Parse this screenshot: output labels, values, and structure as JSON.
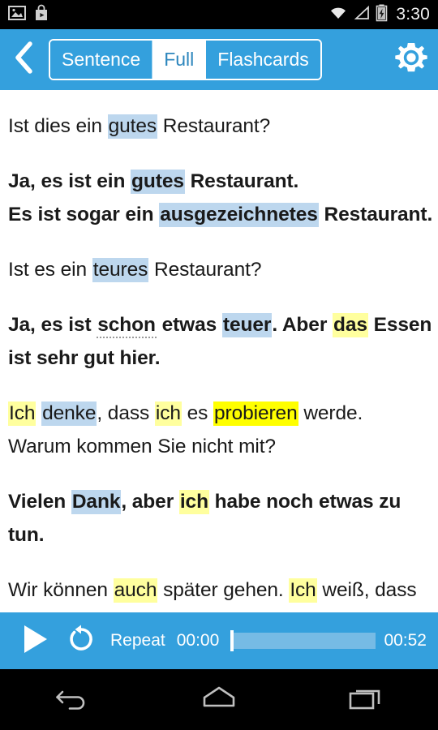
{
  "status_bar": {
    "time": "3:30",
    "left_icons": [
      "screenshot-image-icon",
      "play-store-icon"
    ],
    "right_icons": [
      "wifi-icon",
      "cell-signal-icon",
      "battery-charging-icon"
    ]
  },
  "header": {
    "back_icon": "chevron-left-icon",
    "settings_icon": "gear-icon",
    "tabs": [
      {
        "label": "Sentence",
        "active": false
      },
      {
        "label": "Full",
        "active": true
      },
      {
        "label": "Flashcards",
        "active": false
      }
    ],
    "accent_color": "#34a0dd"
  },
  "colors": {
    "highlight_blue": "#bdd7ee",
    "highlight_yellow_pale": "#ffff9e",
    "highlight_yellow_bright": "#ffff00",
    "text": "#1a1a1a",
    "header_blue": "#34a0dd",
    "seek_track": "#76bbe5"
  },
  "transcript": {
    "paragraphs": [
      {
        "id": "p1",
        "bold": false,
        "lines": [
          [
            {
              "t": "Ist dies ein ",
              "h": "none"
            },
            {
              "t": "gutes",
              "h": "blue"
            },
            {
              "t": " Restaurant?",
              "h": "none"
            }
          ]
        ]
      },
      {
        "id": "p2",
        "bold": true,
        "lines": [
          [
            {
              "t": "Ja, es ist ein ",
              "h": "none"
            },
            {
              "t": "gutes",
              "h": "blue"
            },
            {
              "t": " Restaurant.",
              "h": "none"
            }
          ],
          [
            {
              "t": "Es ist sogar ein ",
              "h": "none"
            },
            {
              "t": "ausgezeichnetes",
              "h": "blue"
            },
            {
              "t": " Restaurant.",
              "h": "none"
            }
          ]
        ]
      },
      {
        "id": "p3",
        "bold": false,
        "lines": [
          [
            {
              "t": "Ist es ein ",
              "h": "none"
            },
            {
              "t": "teures",
              "h": "blue"
            },
            {
              "t": " Restaurant?",
              "h": "none"
            }
          ]
        ]
      },
      {
        "id": "p4",
        "bold": true,
        "lines": [
          [
            {
              "t": "Ja, es ist ",
              "h": "none"
            },
            {
              "t": "schon",
              "h": "dotted"
            },
            {
              "t": " etwas ",
              "h": "none"
            },
            {
              "t": "teuer",
              "h": "blue"
            },
            {
              "t": ". Aber ",
              "h": "none"
            },
            {
              "t": "das",
              "h": "yellow-pale"
            },
            {
              "t": " Essen",
              "h": "none"
            }
          ],
          [
            {
              "t": "ist sehr gut hier.",
              "h": "none"
            }
          ]
        ]
      },
      {
        "id": "p5",
        "bold": false,
        "lines": [
          [
            {
              "t": "Ich",
              "h": "yellow-pale"
            },
            {
              "t": " ",
              "h": "none"
            },
            {
              "t": "denke",
              "h": "blue"
            },
            {
              "t": ", dass ",
              "h": "none"
            },
            {
              "t": "ich",
              "h": "yellow-pale"
            },
            {
              "t": " es ",
              "h": "none"
            },
            {
              "t": "probieren",
              "h": "yellow-bright"
            },
            {
              "t": " werde.",
              "h": "none"
            }
          ],
          [
            {
              "t": "Warum kommen Sie nicht mit?",
              "h": "none"
            }
          ]
        ]
      },
      {
        "id": "p6",
        "bold": true,
        "lines": [
          [
            {
              "t": "Vielen ",
              "h": "none"
            },
            {
              "t": "Dank",
              "h": "blue"
            },
            {
              "t": ", aber ",
              "h": "none"
            },
            {
              "t": "ich",
              "h": "yellow-pale"
            },
            {
              "t": " habe noch etwas zu",
              "h": "none"
            }
          ],
          [
            {
              "t": "tun.",
              "h": "none"
            }
          ]
        ]
      },
      {
        "id": "p7",
        "bold": false,
        "clipped": true,
        "lines": [
          [
            {
              "t": "Wir können ",
              "h": "none"
            },
            {
              "t": "auch",
              "h": "yellow-pale"
            },
            {
              "t": " später gehen. ",
              "h": "none"
            },
            {
              "t": "Ich",
              "h": "yellow-pale"
            },
            {
              "t": " weiß, dass",
              "h": "none"
            }
          ]
        ]
      }
    ]
  },
  "player": {
    "play_icon": "play-icon",
    "repeat_icon": "repeat-rotate-left-icon",
    "repeat_label": "Repeat",
    "current_time": "00:00",
    "total_time": "00:52",
    "progress_percent": 0
  },
  "nav_bar": {
    "back_icon": "nav-back-icon",
    "home_icon": "nav-home-icon",
    "recents_icon": "nav-recents-icon"
  }
}
